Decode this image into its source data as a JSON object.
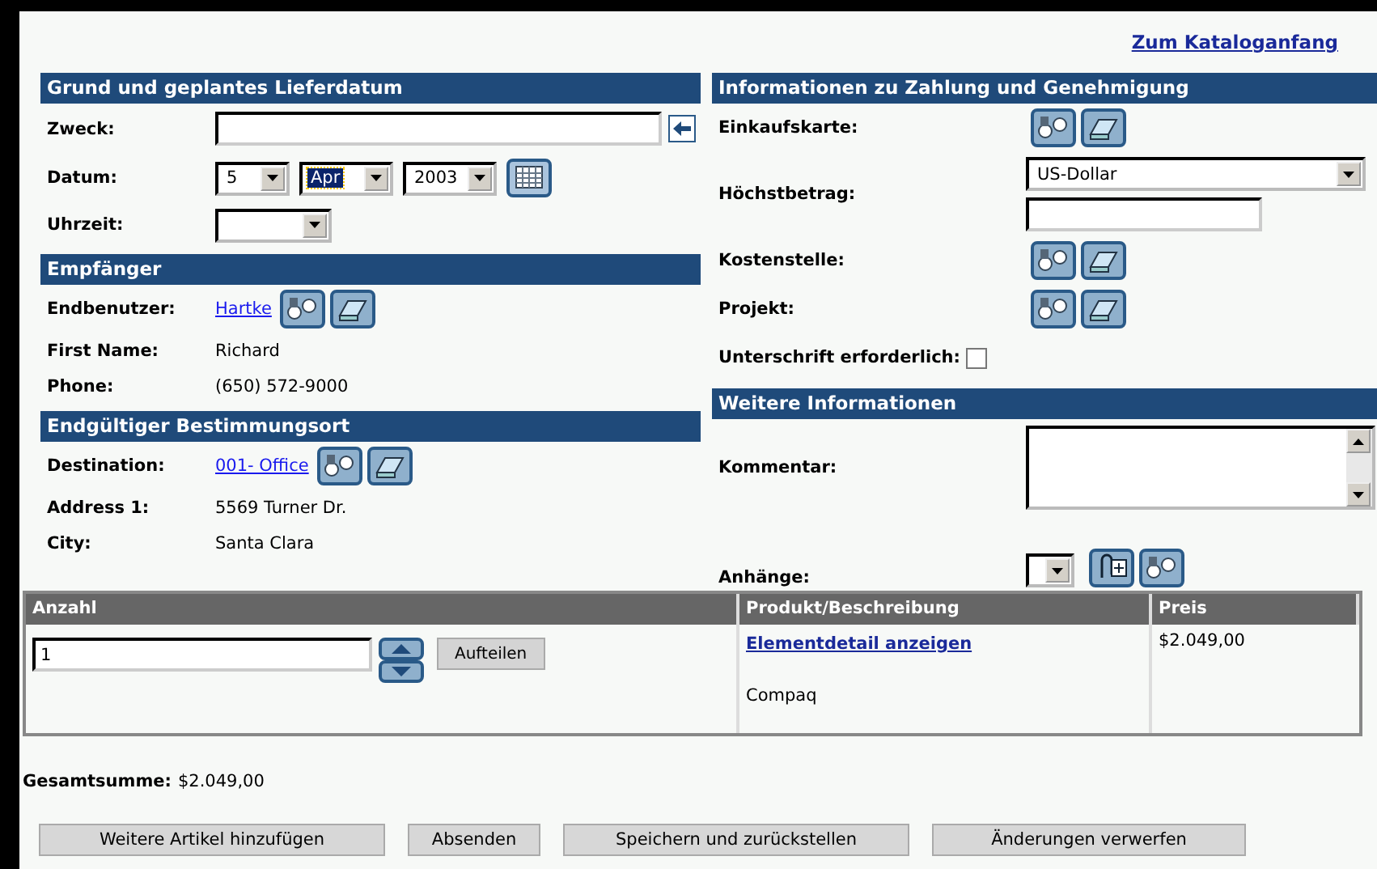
{
  "top_link": "Zum Kataloganfang",
  "left_sections": [
    {
      "title": "Grund und geplantes Lieferdatum",
      "rows": [
        {
          "kind": "input",
          "label": "Zweck:"
        },
        {
          "kind": "date",
          "label": "Datum:",
          "selects": [
            {
              "value": "5",
              "highlighted": false
            },
            {
              "value": "Apr",
              "highlighted": true
            },
            {
              "value": "2003",
              "highlighted": false
            }
          ]
        },
        {
          "kind": "select",
          "label": "Uhrzeit:"
        }
      ]
    },
    {
      "title": "Empfänger",
      "rows": [
        {
          "kind": "link",
          "label": "Endbenutzer:",
          "link": "Hartke"
        },
        {
          "kind": "text",
          "label": "First Name:",
          "value": "Richard"
        },
        {
          "kind": "text",
          "label": "Phone:",
          "value": "(650) 572-9000"
        }
      ]
    },
    {
      "title": "Endgültiger Bestimmungsort",
      "rows": [
        {
          "kind": "link",
          "label": "Destination:",
          "link": "001- Office"
        },
        {
          "kind": "text",
          "label": "Address 1:",
          "value": "5569 Turner Dr."
        },
        {
          "kind": "text",
          "label": "City:",
          "value": "Santa Clara"
        }
      ]
    }
  ],
  "right_sections": [
    {
      "title": "Informationen zu Zahlung und Genehmigung",
      "rows": [
        {
          "kind": "icons",
          "label": "Einkaufskarte:"
        },
        {
          "kind": "amount",
          "label": "Höchstbetrag:",
          "currency": "US-Dollar"
        },
        {
          "kind": "icons",
          "label": "Kostenstelle:"
        },
        {
          "kind": "icons",
          "label": "Projekt:"
        },
        {
          "kind": "checkbox",
          "label": "Unterschrift erforderlich:",
          "checked": false
        }
      ]
    },
    {
      "title": "Weitere Informationen",
      "rows": [
        {
          "kind": "textarea",
          "label": "Kommentar:"
        },
        {
          "kind": "attach",
          "label": "Anhänge:"
        }
      ]
    }
  ],
  "table": {
    "columns": [
      "Anzahl",
      "Produkt/Beschreibung",
      "Preis"
    ],
    "rows": [
      {
        "quantity": "1",
        "split": "Aufteilen",
        "link": "Elementdetail anzeigen",
        "description": "Compaq",
        "price": "$2.049,00"
      }
    ]
  },
  "total": {
    "label": "Gesamtsumme:",
    "value": "$2.049,00"
  },
  "buttons": [
    "Weitere Artikel hinzufügen",
    "Absenden",
    "Speichern und zurückstellen",
    "Änderungen verwerfen"
  ]
}
